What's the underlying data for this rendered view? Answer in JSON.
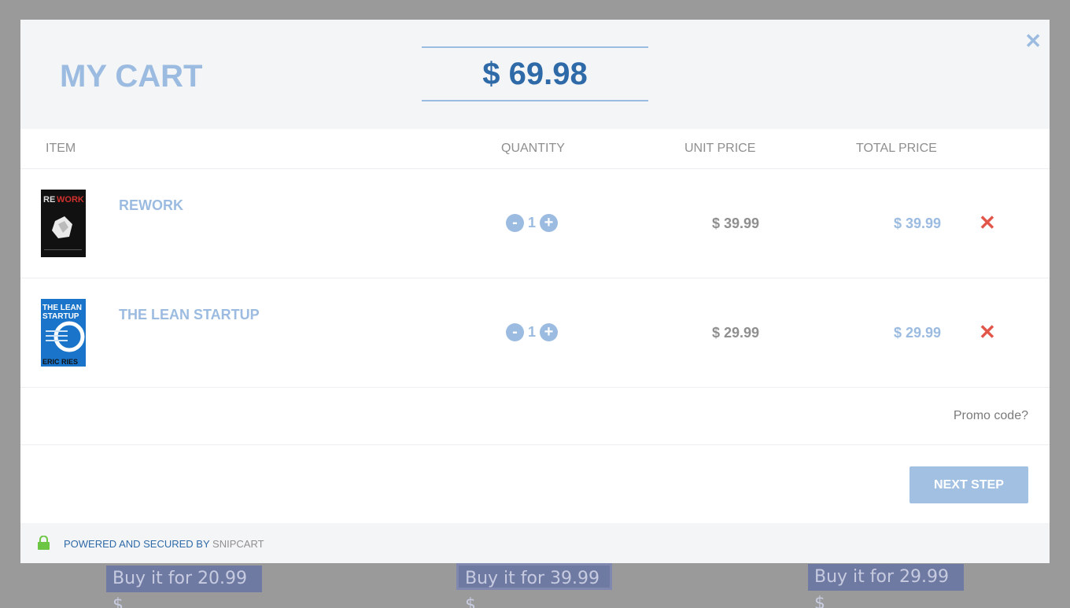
{
  "background_buttons": [
    {
      "label": "Buy it for 20.99 $"
    },
    {
      "label": "Buy it for 39.99 $"
    },
    {
      "label": "Buy it for 29.99 $"
    }
  ],
  "modal": {
    "title": "MY CART",
    "cart_total": "$ 69.98",
    "close_icon": "close-icon"
  },
  "columns": {
    "item": "ITEM",
    "quantity": "QUANTITY",
    "unit_price": "UNIT PRICE",
    "total_price": "TOTAL PRICE"
  },
  "items": [
    {
      "name": "REWORK",
      "quantity": "1",
      "unit_price": "$ 39.99",
      "total_price": "$ 39.99",
      "cover": "rework-book-cover"
    },
    {
      "name": "THE LEAN STARTUP",
      "quantity": "1",
      "unit_price": "$ 29.99",
      "total_price": "$ 29.99",
      "cover": "lean-startup-book-cover"
    }
  ],
  "quantity_controls": {
    "decrement": "-",
    "increment": "+"
  },
  "remove_icon": "✕",
  "promo_link": "Promo code?",
  "next_button": "NEXT STEP",
  "footer": {
    "powered_text": "POWERED AND SECURED BY",
    "brand": "SNIPCART",
    "icon": "lock-icon"
  },
  "colors": {
    "accent": "#9bbbe0",
    "accent_dark": "#2f6aa8",
    "remove": "#e2564a",
    "lock": "#6cc644"
  }
}
